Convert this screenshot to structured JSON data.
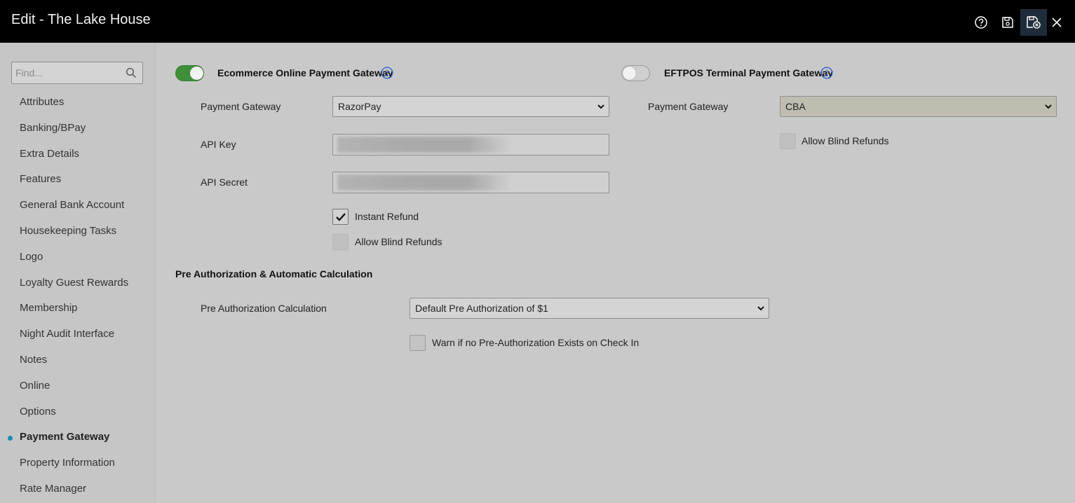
{
  "window": {
    "title": "Edit - The Lake House",
    "actions": {
      "help_icon": "help-circle-icon",
      "save_icon": "save-icon",
      "save_close_icon": "save-close-icon",
      "close_icon": "close-icon"
    }
  },
  "sidebar": {
    "search": {
      "placeholder": "Find...",
      "value": "",
      "icon": "search-icon"
    },
    "items": [
      {
        "label": "Attributes"
      },
      {
        "label": "Banking/BPay"
      },
      {
        "label": "Extra Details"
      },
      {
        "label": "Features"
      },
      {
        "label": "General Bank Account"
      },
      {
        "label": "Housekeeping Tasks"
      },
      {
        "label": "Logo"
      },
      {
        "label": "Loyalty Guest Rewards"
      },
      {
        "label": "Membership"
      },
      {
        "label": "Night Audit Interface"
      },
      {
        "label": "Notes"
      },
      {
        "label": "Online"
      },
      {
        "label": "Options"
      },
      {
        "label": "Payment Gateway",
        "active": true
      },
      {
        "label": "Property Information"
      },
      {
        "label": "Rate Manager"
      }
    ]
  },
  "ecommerce": {
    "enabled": true,
    "title": "Ecommerce Online Payment Gateway",
    "payment_gateway_label": "Payment Gateway",
    "payment_gateway_value": "RazorPay",
    "api_key_label": "API Key",
    "api_secret_label": "API Secret",
    "instant_refund_label": "Instant Refund",
    "instant_refund_checked": true,
    "allow_blind_refunds_label": "Allow Blind Refunds",
    "allow_blind_refunds_checked": false
  },
  "eftpos": {
    "enabled": false,
    "title": "EFTPOS Terminal Payment Gateway",
    "payment_gateway_label": "Payment Gateway",
    "payment_gateway_value": "CBA",
    "allow_blind_refunds_label": "Allow Blind Refunds",
    "allow_blind_refunds_checked": false
  },
  "preauth": {
    "section_title": "Pre Authorization & Automatic Calculation",
    "calculation_label": "Pre Authorization Calculation",
    "calculation_value": "Default Pre Authorization of $1",
    "warn_label": "Warn if no Pre-Authorization Exists on Check In",
    "warn_checked": false
  },
  "colors": {
    "toggle_on": "#3f8f3a",
    "active_dot": "#1a8fb3",
    "info_icon": "#2f62c9",
    "titlebar": "#000000"
  }
}
